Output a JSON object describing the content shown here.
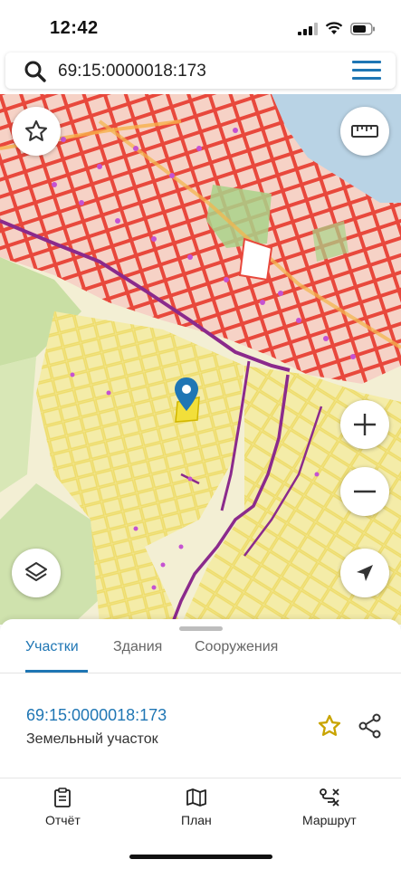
{
  "status_bar": {
    "time": "12:42"
  },
  "search": {
    "value": "69:15:0000018:173",
    "placeholder": ""
  },
  "map": {
    "colors": {
      "urban_bg": "#f6d2c6",
      "parcel_red": "#e8483c",
      "parcel_yellow": "#f2e58a",
      "field_yellow": "#f4eca8",
      "green": "#a9d48a",
      "water": "#b9d3e5",
      "boundary_purple": "#8b2a8c",
      "pin_blue": "#1f76b4",
      "parcel_highlight": "#f2df3a"
    },
    "buttons": {
      "favorite": "star-icon",
      "ruler": "ruler-icon",
      "zoom_in": "plus-icon",
      "zoom_out": "minus-icon",
      "layers": "layers-icon",
      "locate": "navigation-arrow-icon"
    }
  },
  "sheet": {
    "tabs": [
      {
        "label": "Участки",
        "active": true
      },
      {
        "label": "Здания",
        "active": false
      },
      {
        "label": "Сооружения",
        "active": false
      }
    ],
    "result": {
      "number": "69:15:0000018:173",
      "type": "Земельный участок"
    }
  },
  "bottom_nav": [
    {
      "label": "Отчёт",
      "icon": "report-icon"
    },
    {
      "label": "План",
      "icon": "map-plan-icon"
    },
    {
      "label": "Маршрут",
      "icon": "route-icon"
    }
  ]
}
